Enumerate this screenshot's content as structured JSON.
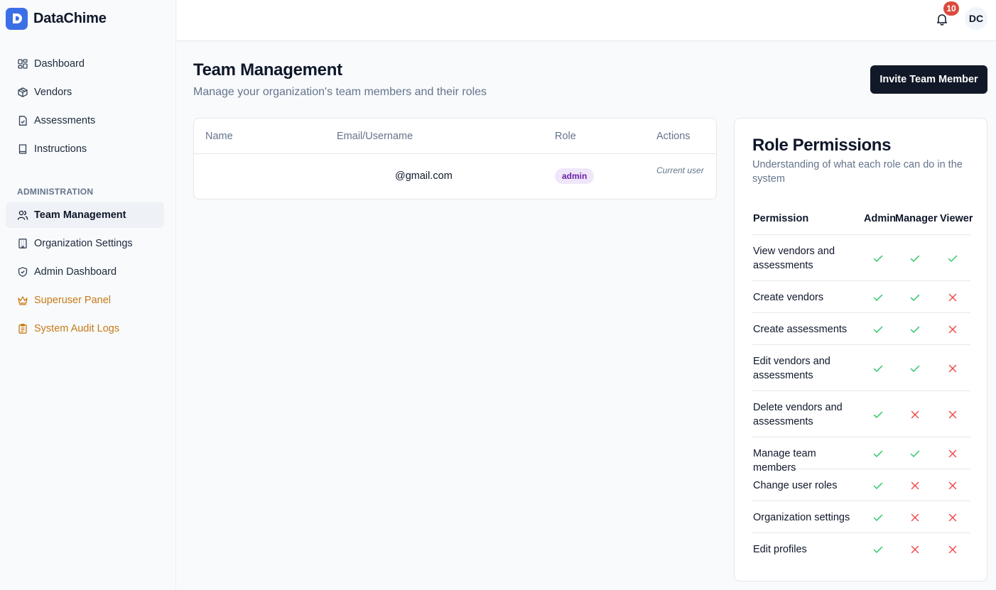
{
  "brand": {
    "name": "DataChime",
    "accent": "#3b6fe6"
  },
  "sidebar": {
    "items": [
      {
        "label": "Dashboard",
        "icon": "layout-grid-icon"
      },
      {
        "label": "Vendors",
        "icon": "package-icon"
      },
      {
        "label": "Assessments",
        "icon": "file-check-icon"
      },
      {
        "label": "Instructions",
        "icon": "book-icon"
      }
    ],
    "section_label": "ADMINISTRATION",
    "admin_items": [
      {
        "label": "Team Management",
        "icon": "users-icon",
        "active": true
      },
      {
        "label": "Organization Settings",
        "icon": "building-icon"
      },
      {
        "label": "Admin Dashboard",
        "icon": "shield-check-icon"
      },
      {
        "label": "Superuser Panel",
        "icon": "crown-icon",
        "color": "#c77a14"
      },
      {
        "label": "System Audit Logs",
        "icon": "clipboard-list-icon",
        "color": "#c77a14"
      }
    ]
  },
  "topbar": {
    "notification_count": "10",
    "avatar_initials": "DC"
  },
  "main": {
    "title": "Team Management",
    "subtitle": "Manage your organization's team members and their roles",
    "invite_label": "Invite Team Member"
  },
  "team_table": {
    "headers": {
      "name": "Name",
      "email": "Email/Username",
      "role": "Role",
      "actions": "Actions"
    },
    "rows": [
      {
        "name": "",
        "email": "@gmail.com",
        "role": "admin",
        "action": "Current user"
      }
    ]
  },
  "permissions": {
    "title": "Role Permissions",
    "subtitle": "Understanding of what each role can do in the system",
    "headers": {
      "permission": "Permission",
      "admin": "Admin",
      "manager": "Manager",
      "viewer": "Viewer"
    },
    "rows": [
      {
        "label": "View vendors and assessments",
        "admin": true,
        "manager": true,
        "viewer": true
      },
      {
        "label": "Create vendors",
        "admin": true,
        "manager": true,
        "viewer": false
      },
      {
        "label": "Create assessments",
        "admin": true,
        "manager": true,
        "viewer": false
      },
      {
        "label": "Edit vendors and assessments",
        "admin": true,
        "manager": true,
        "viewer": false
      },
      {
        "label": "Delete vendors and assessments",
        "admin": true,
        "manager": false,
        "viewer": false
      },
      {
        "label": "Manage team members",
        "admin": true,
        "manager": true,
        "viewer": false
      },
      {
        "label": "Change user roles",
        "admin": true,
        "manager": false,
        "viewer": false
      },
      {
        "label": "Organization settings",
        "admin": true,
        "manager": false,
        "viewer": false
      },
      {
        "label": "Edit profiles",
        "admin": true,
        "manager": false,
        "viewer": false
      }
    ],
    "allowed_color": "#22c55e",
    "denied_color": "#ef4444"
  }
}
